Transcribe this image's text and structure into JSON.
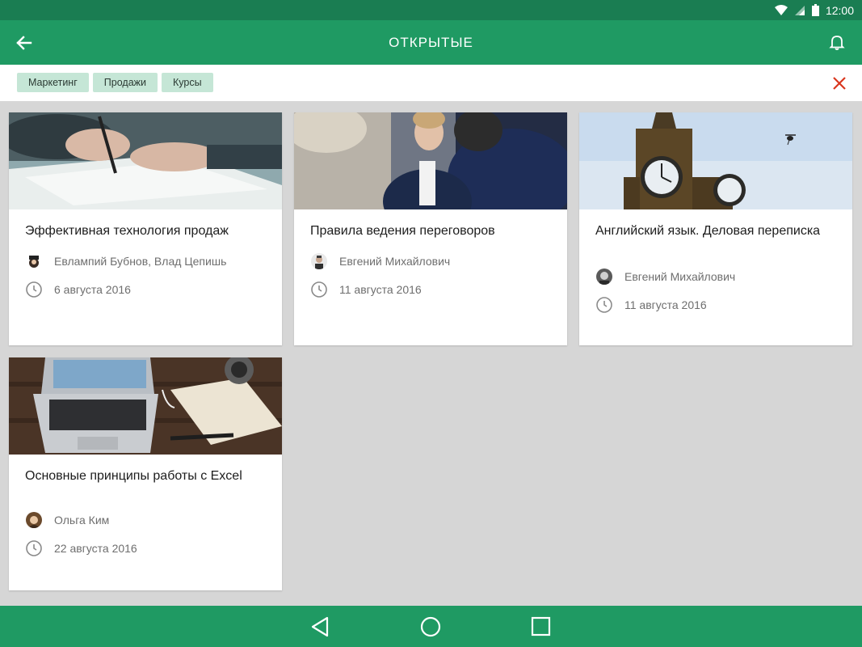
{
  "status_bar": {
    "time": "12:00",
    "icons": [
      "wifi-icon",
      "signal-icon",
      "battery-icon"
    ]
  },
  "app_bar": {
    "title": "ОТКРЫТЫЕ",
    "back_icon": "arrow-left-icon",
    "notifications_icon": "bell-icon"
  },
  "filters": {
    "chips": [
      "Маркетинг",
      "Продажи",
      "Курсы"
    ],
    "clear_icon": "close-icon"
  },
  "courses": [
    {
      "title": "Эффективная технология продаж",
      "authors": "Евлампий Бубнов, Влад Цепишь",
      "date": "6 августа 2016"
    },
    {
      "title": "Правила ведения переговоров",
      "authors": "Евгений Михайлович",
      "date": "11 августа 2016"
    },
    {
      "title": "Английский язык. Деловая переписка",
      "authors": "Евгений Михайлович",
      "date": "11 августа 2016"
    },
    {
      "title": "Основные принципы работы с Excel",
      "authors": "Ольга Ким",
      "date": "22 августа 2016"
    }
  ],
  "nav_bar": {
    "icons": [
      "nav-back-icon",
      "nav-home-icon",
      "nav-recents-icon"
    ]
  },
  "colors": {
    "primary": "#1f9a63",
    "status_bar": "#1a7d52",
    "chip": "#c5e6d6",
    "clear": "#d9361e",
    "background": "#d6d6d6"
  }
}
